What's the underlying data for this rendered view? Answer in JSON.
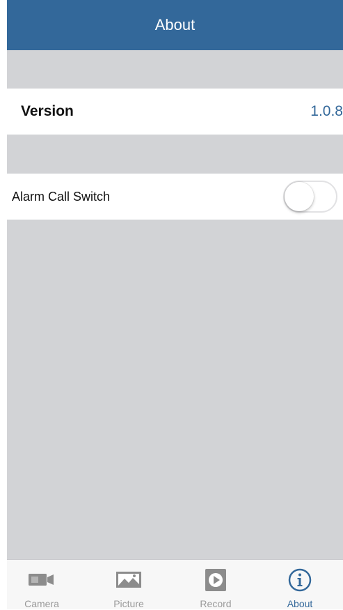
{
  "header": {
    "title": "About"
  },
  "settings": {
    "version": {
      "label": "Version",
      "value": "1.0.8"
    },
    "alarm_call_switch": {
      "label": "Alarm Call Switch",
      "on": false
    }
  },
  "tabbar": {
    "tabs": [
      {
        "label": "Camera",
        "icon": "camera-icon",
        "active": false
      },
      {
        "label": "Picture",
        "icon": "picture-icon",
        "active": false
      },
      {
        "label": "Record",
        "icon": "record-icon",
        "active": false
      },
      {
        "label": "About",
        "icon": "info-icon",
        "active": true
      }
    ]
  },
  "colors": {
    "accent": "#33689a",
    "background": "#d2d3d6",
    "inactive_tab": "#9a9a9a"
  }
}
